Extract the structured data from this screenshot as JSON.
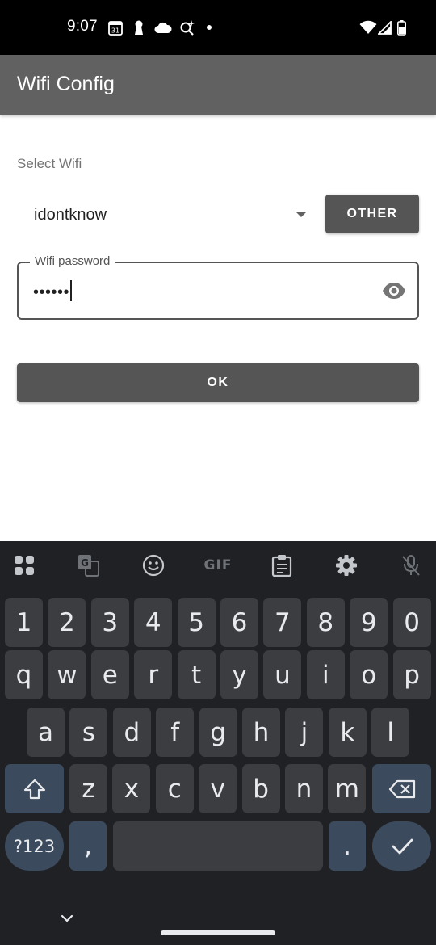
{
  "status_bar": {
    "time": "9:07",
    "calendar_day": "31"
  },
  "app_bar": {
    "title": "Wifi Config"
  },
  "form": {
    "select_label": "Select Wifi",
    "selected_wifi": "idontknow",
    "other_button": "OTHER",
    "password_label": "Wifi password",
    "password_value": "••••••",
    "ok_button": "OK"
  },
  "keyboard": {
    "toolbar_gif": "GIF",
    "row_numbers": [
      "1",
      "2",
      "3",
      "4",
      "5",
      "6",
      "7",
      "8",
      "9",
      "0"
    ],
    "row_top": [
      "q",
      "w",
      "e",
      "r",
      "t",
      "y",
      "u",
      "i",
      "o",
      "p"
    ],
    "row_middle": [
      "a",
      "s",
      "d",
      "f",
      "g",
      "h",
      "j",
      "k",
      "l"
    ],
    "row_bottom": [
      "z",
      "x",
      "c",
      "v",
      "b",
      "n",
      "m"
    ],
    "symbols_key": "?123",
    "comma_key": ",",
    "period_key": "."
  },
  "colors": {
    "app_bar": "#616161",
    "button": "#555555",
    "keyboard_bg": "#202124",
    "key_bg": "#3c3d40",
    "special_key_bg": "#3b4a5c"
  }
}
